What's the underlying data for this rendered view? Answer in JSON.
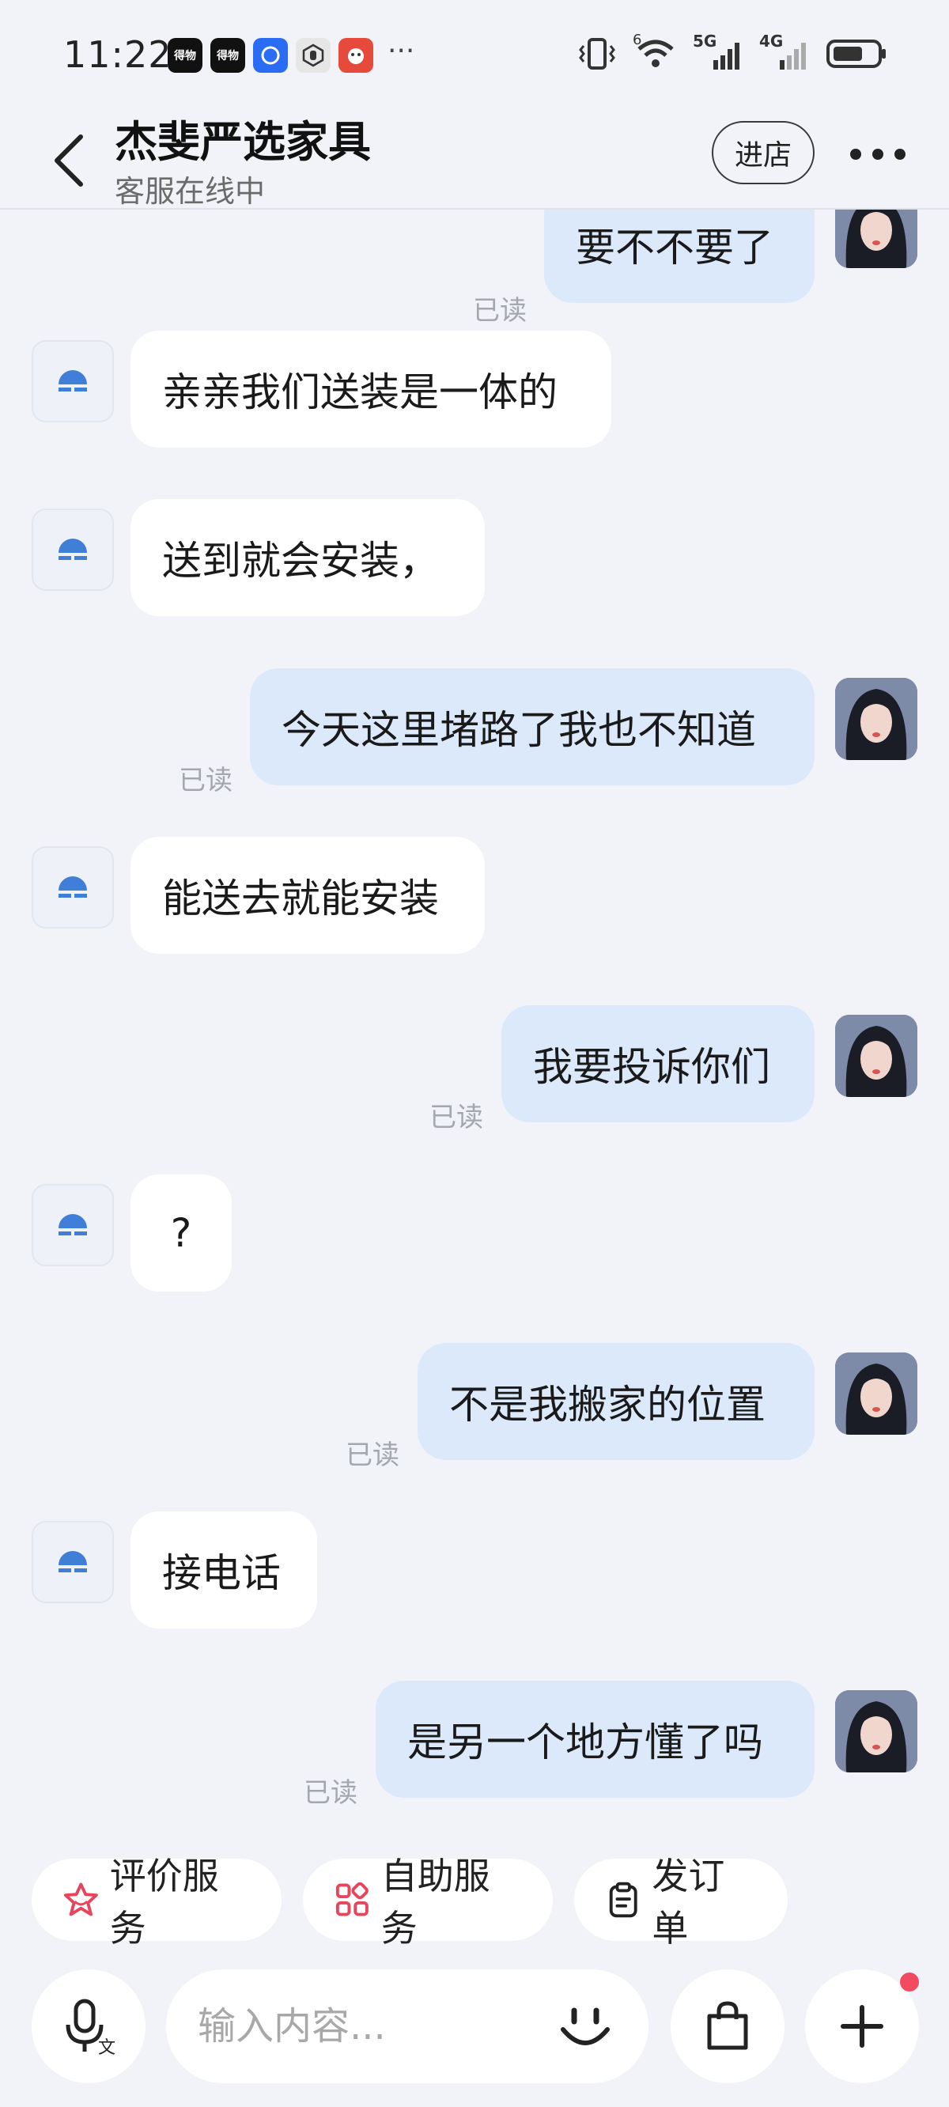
{
  "status_bar": {
    "time": "11:22",
    "app_icons": [
      {
        "label": "得物",
        "color": "#111111"
      },
      {
        "label": "得物",
        "color": "#111111"
      },
      {
        "label": "",
        "color": "#2a6df4"
      },
      {
        "label": "",
        "color": "#e8e8e8"
      },
      {
        "label": "",
        "color": "#e54a3a"
      }
    ],
    "more": "···",
    "network_5g": "5G",
    "network_4g": "4G",
    "wifi_badge": "6"
  },
  "header": {
    "title": "杰斐严选家具",
    "subtitle": "客服在线中",
    "enter_shop": "进店"
  },
  "messages": [
    {
      "from": "user",
      "text": "要不不要了",
      "read": "已读"
    },
    {
      "from": "agent",
      "text": "亲亲我们送装是一体的"
    },
    {
      "from": "agent",
      "text": "送到就会安装，"
    },
    {
      "from": "user",
      "text": "今天这里堵路了我也不知道",
      "read": "已读"
    },
    {
      "from": "agent",
      "text": "能送去就能安装"
    },
    {
      "from": "user",
      "text": "我要投诉你们",
      "read": "已读"
    },
    {
      "from": "agent",
      "text": "?"
    },
    {
      "from": "user",
      "text": "不是我搬家的位置",
      "read": "已读"
    },
    {
      "from": "agent",
      "text": "接电话"
    },
    {
      "from": "user",
      "text": "是另一个地方懂了吗",
      "read": "已读"
    }
  ],
  "quick_actions": [
    {
      "label": "评价服务",
      "icon": "star-icon",
      "color": "#e8455c"
    },
    {
      "label": "自助服务",
      "icon": "grid-icon",
      "color": "#e8455c"
    },
    {
      "label": "发订单",
      "icon": "clipboard-icon",
      "color": "#222222"
    }
  ],
  "input": {
    "placeholder": "输入内容..."
  },
  "colors": {
    "background": "#f1f3f8",
    "user_bubble": "#dbe9fb",
    "agent_bubble": "#ffffff",
    "agent_logo": "#3f7fd8",
    "notification_dot": "#f24a5e"
  }
}
